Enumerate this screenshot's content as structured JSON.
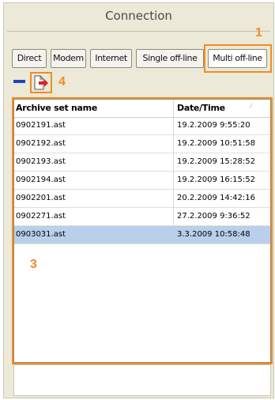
{
  "window": {
    "title": "Connection"
  },
  "tabs": [
    {
      "label": "Direct"
    },
    {
      "label": "Modem"
    },
    {
      "label": "Internet"
    },
    {
      "label": "Single off-line"
    },
    {
      "label": "Multi off-line"
    }
  ],
  "toolbar": {
    "remove_icon": "minus-icon",
    "export_icon": "export-icon"
  },
  "table": {
    "columns": [
      "Archive set name",
      "Date/Time"
    ],
    "sort_indicator": "⁄",
    "rows": [
      {
        "name": "0902191.ast",
        "datetime": "19.2.2009 9:55:20"
      },
      {
        "name": "0902192.ast",
        "datetime": "19.2.2009 10:51:58"
      },
      {
        "name": "0902193.ast",
        "datetime": "19.2.2009 15:28:52"
      },
      {
        "name": "0902194.ast",
        "datetime": "19.2.2009 16:15:52"
      },
      {
        "name": "0902201.ast",
        "datetime": "20.2.2009 14:42:16"
      },
      {
        "name": "0902271.ast",
        "datetime": "27.2.2009 9:36:52"
      },
      {
        "name": "0903031.ast",
        "datetime": "3.3.2009 10:58:48"
      }
    ],
    "selected_row": 6
  },
  "callouts": {
    "c1": "1",
    "c3": "3",
    "c4": "4"
  },
  "colors": {
    "callout": "#f28c1f",
    "selection": "#b9d0ec",
    "icon_blue": "#1f44c4",
    "icon_red": "#e02020"
  }
}
